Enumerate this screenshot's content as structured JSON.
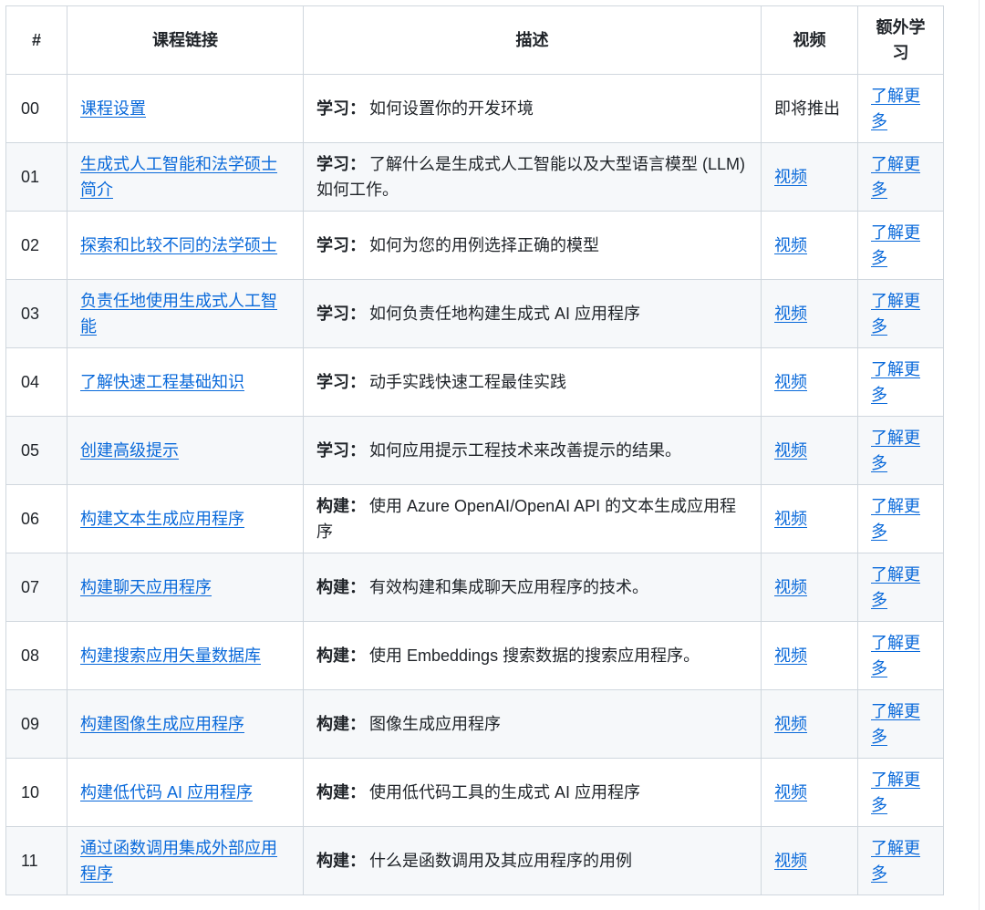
{
  "headers": {
    "num": "#",
    "course": "课程链接",
    "desc": "描述",
    "video": "视频",
    "extra": "额外学习"
  },
  "rows": [
    {
      "num": "00",
      "course": "课程设置",
      "kind": "学习：",
      "desc": "如何设置你的开发环境",
      "video": "即将推出",
      "video_is_link": false,
      "extra": "了解更多"
    },
    {
      "num": "01",
      "course": "生成式人工智能和法学硕士简介",
      "kind": "学习：",
      "desc": "了解什么是生成式人工智能以及大型语言模型 (LLM) 如何工作。",
      "video": "视频",
      "video_is_link": true,
      "extra": "了解更多"
    },
    {
      "num": "02",
      "course": "探索和比较不同的法学硕士",
      "kind": "学习：",
      "desc": "如何为您的用例选择正确的模型",
      "video": "视频",
      "video_is_link": true,
      "extra": "了解更多"
    },
    {
      "num": "03",
      "course": "负责任地使用生成式人工智能",
      "kind": "学习：",
      "desc": "如何负责任地构建生成式 AI 应用程序",
      "video": "视频",
      "video_is_link": true,
      "extra": "了解更多"
    },
    {
      "num": "04",
      "course": "了解快速工程基础知识",
      "kind": "学习：",
      "desc": "动手实践快速工程最佳实践",
      "video": "视频",
      "video_is_link": true,
      "extra": "了解更多"
    },
    {
      "num": "05",
      "course": "创建高级提示",
      "kind": "学习：",
      "desc": "如何应用提示工程技术来改善提示的结果。",
      "video": "视频",
      "video_is_link": true,
      "extra": "了解更多"
    },
    {
      "num": "06",
      "course": "构建文本生成应用程序",
      "kind": "构建：",
      "desc": "使用 Azure OpenAI/OpenAI API 的文本生成应用程序",
      "video": "视频",
      "video_is_link": true,
      "extra": "了解更多"
    },
    {
      "num": "07",
      "course": "构建聊天应用程序",
      "kind": "构建：",
      "desc": "有效构建和集成聊天应用程序的技术。",
      "video": "视频",
      "video_is_link": true,
      "extra": "了解更多"
    },
    {
      "num": "08",
      "course": "构建搜索应用矢量数据库",
      "kind": "构建：",
      "desc": "使用 Embeddings 搜索数据的搜索应用程序。",
      "video": "视频",
      "video_is_link": true,
      "extra": "了解更多"
    },
    {
      "num": "09",
      "course": "构建图像生成应用程序",
      "kind": "构建：",
      "desc": "图像生成应用程序",
      "video": "视频",
      "video_is_link": true,
      "extra": "了解更多"
    },
    {
      "num": "10",
      "course": "构建低代码 AI 应用程序",
      "kind": "构建：",
      "desc": "使用低代码工具的生成式 AI 应用程序",
      "video": "视频",
      "video_is_link": true,
      "extra": "了解更多"
    },
    {
      "num": "11",
      "course": "通过函数调用集成外部应用程序",
      "kind": "构建：",
      "desc": "什么是函数调用及其应用程序的用例",
      "video": "视频",
      "video_is_link": true,
      "extra": "了解更多"
    }
  ]
}
